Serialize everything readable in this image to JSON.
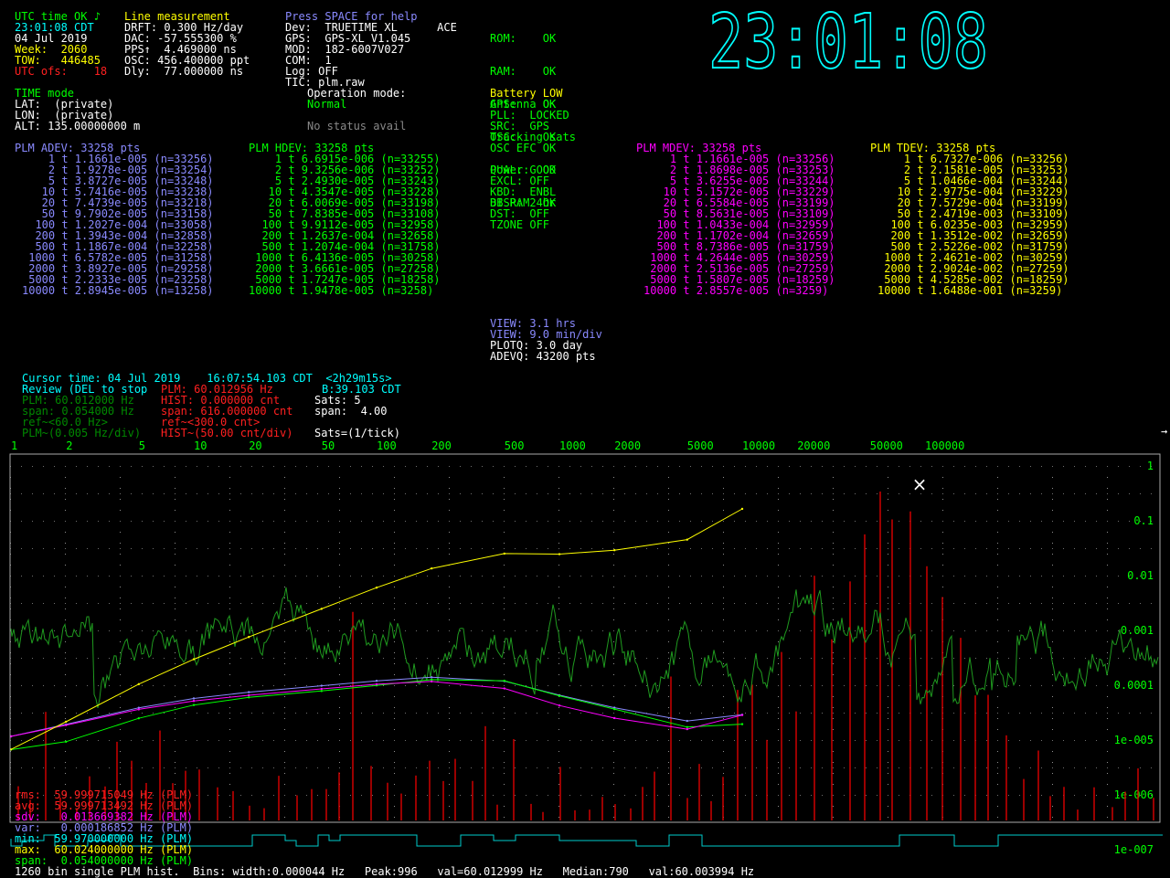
{
  "status_left": {
    "utc_status": "UTC time OK",
    "time": "23:01:08 CDT",
    "date": "04 Jul 2019",
    "week_label": "Week:",
    "week": "2060",
    "tow_label": "TOW:",
    "tow": "446485",
    "utc_ofs_label": "UTC ofs:",
    "utc_ofs": "18",
    "time_mode": "TIME mode",
    "lat": "LAT:  (private)",
    "lon": "LON:  (private)",
    "alt": "ALT: 135.00000000 m"
  },
  "measurement": {
    "title": "Line measurement",
    "drft": "DRFT: 0.300 Hz/day",
    "dac": "DAC: -57.555300 %",
    "pps": "PPS↑  4.469000 ns",
    "osc": "OSC: 456.400000 ppt",
    "dly": "Dly:  77.000000 ns"
  },
  "device": {
    "help": "Press SPACE for help",
    "dev": "Dev:  TRUETIME XL      ACE",
    "gps": "GPS:  GPS-XL V1.045",
    "mod": "MOD:  182-6007V027",
    "com": "COM:  1",
    "log": "Log: OFF",
    "tic": "TIC: plm.raw",
    "op_mode_label": "Operation mode:",
    "op_mode": "Normal",
    "no_status": "No status avail"
  },
  "selftest": {
    "rows": [
      "ROM:    OK",
      "RAM:    OK",
      "GPS:    OK",
      "OSC:    OK",
      "Power:  OK",
      "BB RAM  OK"
    ]
  },
  "alarms": {
    "battery": "Battery LOW",
    "antenna": "Antenna OK",
    "pll": "PLL:  LOCKED",
    "src": "SRC:  GPS",
    "tracking": "Tracking sats",
    "osc_efc": "OSC EFC OK",
    "qual": "QUAL: GOOD",
    "excl": "EXCL: OFF",
    "kbd": "KBD:  ENBL",
    "disp": "DISP: 24hr",
    "dst": "DST:  OFF",
    "tzone": "TZONE OFF"
  },
  "clock": "23:01:08",
  "adev": {
    "title": "PLM ADEV: 33258 pts",
    "rows": [
      "    1 t 1.1661e-005 (n=33256)",
      "    2 t 1.9278e-005 (n=33254)",
      "    5 t 3.8727e-005 (n=33248)",
      "   10 t 5.7416e-005 (n=33238)",
      "   20 t 7.4739e-005 (n=33218)",
      "   50 t 9.7902e-005 (n=33158)",
      "  100 t 1.2027e-004 (n=33058)",
      "  200 t 1.3943e-004 (n=32858)",
      "  500 t 1.1867e-004 (n=32258)",
      " 1000 t 6.5782e-005 (n=31258)",
      " 2000 t 3.8927e-005 (n=29258)",
      " 5000 t 2.2333e-005 (n=23258)",
      "10000 t 2.8945e-005 (n=13258)"
    ]
  },
  "hdev": {
    "title": "PLM HDEV: 33258 pts",
    "rows": [
      "    1 t 6.6915e-006 (n=33255)",
      "    2 t 9.3256e-006 (n=33252)",
      "    5 t 2.4930e-005 (n=33243)",
      "   10 t 4.3547e-005 (n=33228)",
      "   20 t 6.0069e-005 (n=33198)",
      "   50 t 7.8385e-005 (n=33108)",
      "  100 t 9.9112e-005 (n=32958)",
      "  200 t 1.2637e-004 (n=32658)",
      "  500 t 1.2074e-004 (n=31758)",
      " 1000 t 6.4136e-005 (n=30258)",
      " 2000 t 3.6661e-005 (n=27258)",
      " 5000 t 1.7247e-005 (n=18258)",
      "10000 t 1.9478e-005 (n=3258)"
    ]
  },
  "mdev": {
    "title": "PLM MDEV: 33258 pts",
    "rows": [
      "    1 t 1.1661e-005 (n=33256)",
      "    2 t 1.8698e-005 (n=33253)",
      "    5 t 3.6255e-005 (n=33244)",
      "   10 t 5.1572e-005 (n=33229)",
      "   20 t 6.5584e-005 (n=33199)",
      "   50 t 8.5631e-005 (n=33109)",
      "  100 t 1.0433e-004 (n=32959)",
      "  200 t 1.1702e-004 (n=32659)",
      "  500 t 8.7386e-005 (n=31759)",
      " 1000 t 4.2644e-005 (n=30259)",
      " 2000 t 2.5136e-005 (n=27259)",
      " 5000 t 1.5807e-005 (n=18259)",
      "10000 t 2.8557e-005 (n=3259)"
    ]
  },
  "tdev": {
    "title": "PLM TDEV: 33258 pts",
    "rows": [
      "    1 t 6.7327e-006 (n=33256)",
      "    2 t 2.1581e-005 (n=33253)",
      "    5 t 1.0466e-004 (n=33244)",
      "   10 t 2.9775e-004 (n=33229)",
      "   20 t 7.5729e-004 (n=33199)",
      "   50 t 2.4719e-003 (n=33109)",
      "  100 t 6.0235e-003 (n=32959)",
      "  200 t 1.3512e-002 (n=32659)",
      "  500 t 2.5226e-002 (n=31759)",
      " 1000 t 2.4621e-002 (n=30259)",
      " 2000 t 2.9024e-002 (n=27259)",
      " 5000 t 4.5285e-002 (n=18259)",
      "10000 t 1.6488e-001 (n=3259)"
    ]
  },
  "view": {
    "view_hrs": "VIEW: 3.1 hrs",
    "view_div": "VIEW: 9.0 min/div",
    "plotq": "PLOTQ: 3.0 day",
    "adevq": "ADEVQ: 43200 pts"
  },
  "cursor": {
    "cursor_time": "Cursor time: 04 Jul 2019    16:07:54.103 CDT  <2h29m15s>",
    "review": "Review (DEL to stop",
    "plm_val": "PLM: 60.012956 Hz",
    "b_val": "B:39.103 CDT",
    "plm_line": "PLM: 60.012000 Hz",
    "hist_line": "HIST: 0.000000 cnt",
    "sats_line": "Sats: 5",
    "span_line": "span: 0.054000 Hz",
    "span_hist": "span: 616.000000 cnt",
    "span_sats": "span:  4.00",
    "ref_plm": "ref~<60.0 Hz>",
    "ref_hist": "ref~<300.0 cnt>",
    "scale_plm": "PLM~(0.005 Hz/div)",
    "scale_hist": "HIST~(50.00 cnt/div)",
    "scale_sats": "Sats=(1/tick)"
  },
  "chart_data": {
    "type": "line",
    "tau_ticks": [
      "1",
      "2",
      "5",
      "10",
      "20",
      "50",
      "100",
      "200",
      "500",
      "1000",
      "2000",
      "5000",
      "10000",
      "20000",
      "50000",
      "100000"
    ],
    "dev_axis_ticks": [
      "1",
      "0.1",
      "0.01",
      "0.001",
      "0.0001",
      "1e-005",
      "1e-006",
      "1e-007"
    ],
    "tau": [
      1,
      2,
      5,
      10,
      20,
      50,
      100,
      200,
      500,
      1000,
      2000,
      5000,
      10000
    ],
    "series": [
      {
        "name": "ADEV",
        "color": "#8a8aff",
        "values": [
          1.1661e-05,
          1.9278e-05,
          3.8727e-05,
          5.7416e-05,
          7.4739e-05,
          9.7902e-05,
          0.00012027,
          0.00013943,
          0.00011867,
          6.5782e-05,
          3.8927e-05,
          2.2333e-05,
          2.8945e-05
        ]
      },
      {
        "name": "HDEV",
        "color": "#00ff00",
        "values": [
          6.6915e-06,
          9.3256e-06,
          2.493e-05,
          4.3547e-05,
          6.0069e-05,
          7.8385e-05,
          9.9112e-05,
          0.00012637,
          0.00012074,
          6.4136e-05,
          3.6661e-05,
          1.7247e-05,
          1.9478e-05
        ]
      },
      {
        "name": "MDEV",
        "color": "#ff00ff",
        "values": [
          1.1661e-05,
          1.8698e-05,
          3.6255e-05,
          5.1572e-05,
          6.5584e-05,
          8.5631e-05,
          0.00010433,
          0.00011702,
          8.7386e-05,
          4.2644e-05,
          2.5136e-05,
          1.5807e-05,
          2.8557e-05
        ]
      },
      {
        "name": "TDEV",
        "color": "#ffff00",
        "values": [
          6.7327e-06,
          2.1581e-05,
          0.00010466,
          0.00029775,
          0.00075729,
          0.0024719,
          0.0060235,
          0.013512,
          0.025226,
          0.024621,
          0.029024,
          0.045285,
          0.16488
        ]
      }
    ],
    "log_y": true,
    "grid": true
  },
  "stats": {
    "rms": "rms:  59.999715049 Hz (PLM)",
    "avg": "avg:  59.999713492 Hz (PLM)",
    "sdv": "sdv:   0.013669382 Hz (PLM)",
    "var": "var:   0.000186852 Hz (PLM)",
    "min": "min:  59.970000000 Hz (PLM)",
    "max": "max:  60.024000000 Hz (PLM)",
    "span": "span:  0.054000000 Hz (PLM)"
  },
  "footer": "1260 bin single PLM hist.  Bins: width:0.000044 Hz   Peak:996   val=60.012999 Hz   Median:790   val:60.003994 Hz",
  "cursor_marker": "×",
  "scroll_arrow": "→"
}
